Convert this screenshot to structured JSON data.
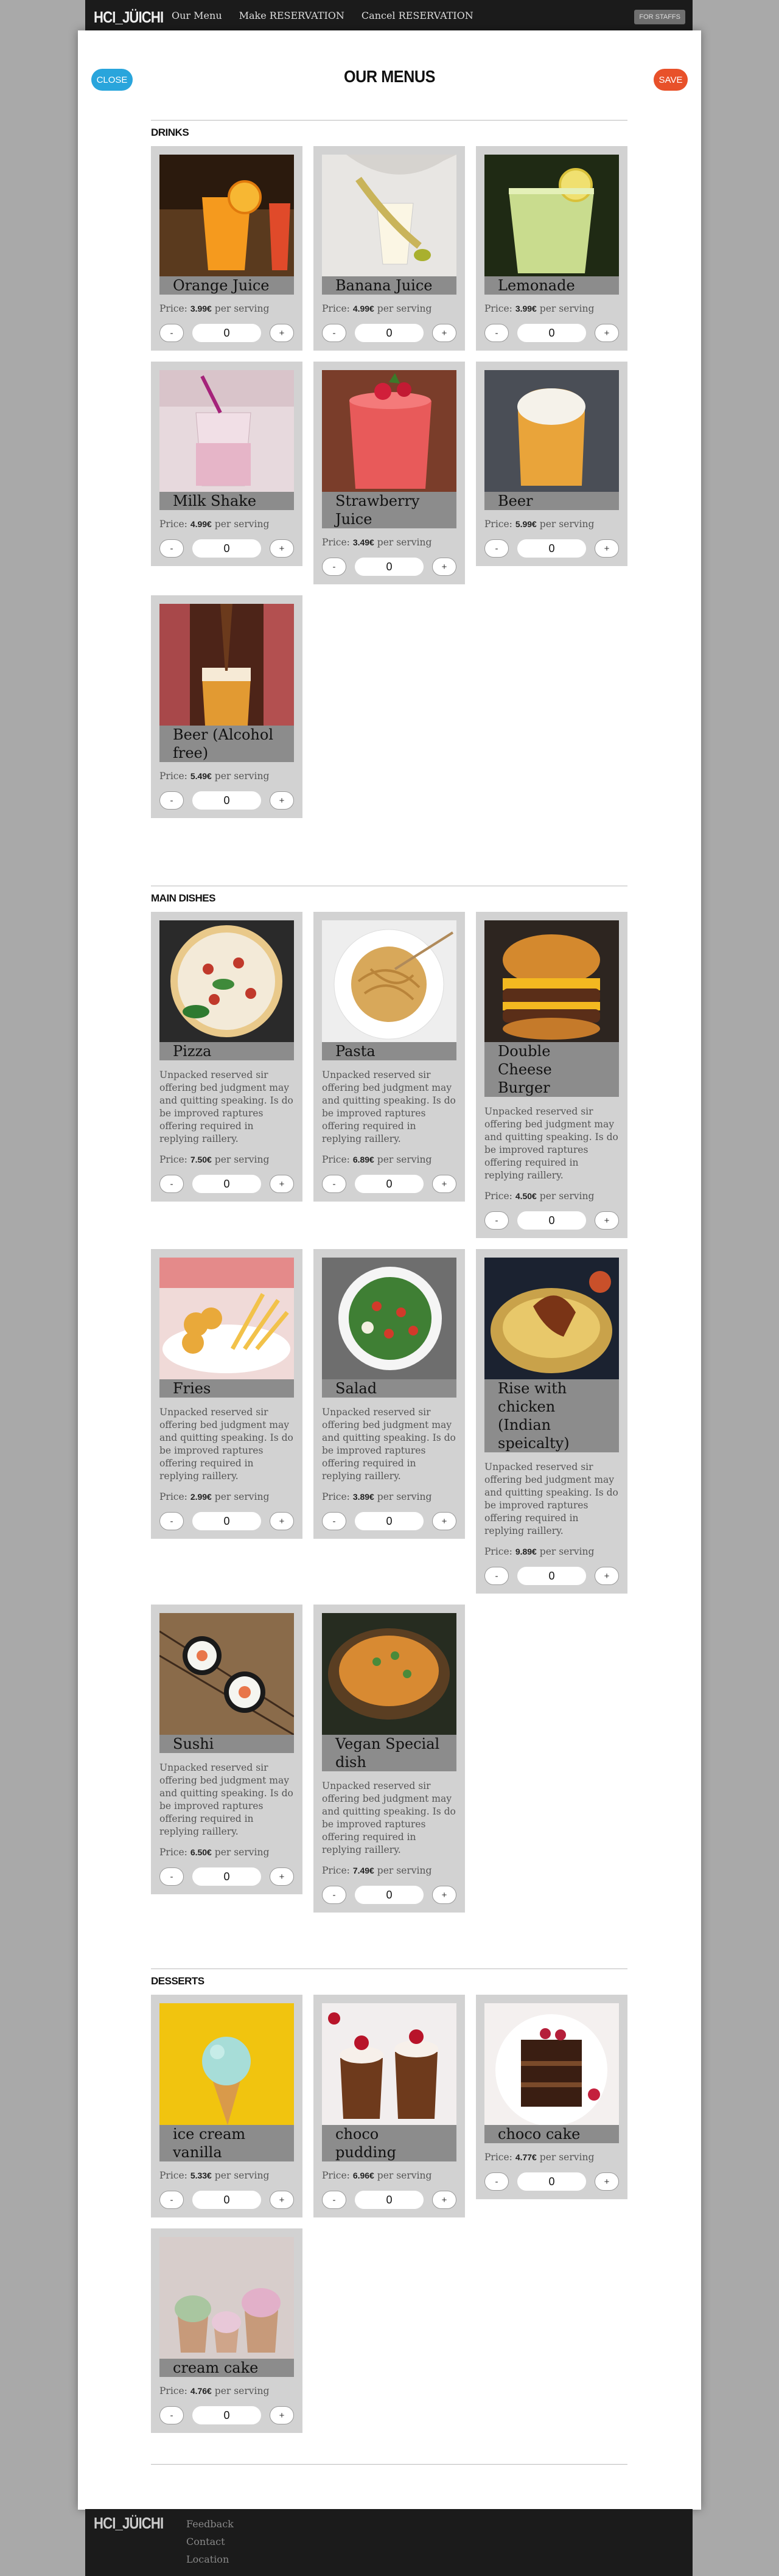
{
  "nav": {
    "brand": "HCI_JÜICHI",
    "links": [
      "Our Menu",
      "Make RESERVATION",
      "Cancel RESERVATION"
    ],
    "staff_button": "FOR STAFFS"
  },
  "modal": {
    "close_label": "CLOSE",
    "save_label": "SAVE",
    "title": "OUR MENUS"
  },
  "labels": {
    "price_prefix": "Price:",
    "per_serving": "per serving",
    "minus": "-",
    "plus": "+"
  },
  "sections": [
    {
      "title": "DRINKS",
      "items": [
        {
          "name": "Orange Juice",
          "price": "3.99€",
          "qty": "0",
          "img": "orange-juice"
        },
        {
          "name": "Banana Juice",
          "price": "4.99€",
          "qty": "0",
          "img": "banana-juice"
        },
        {
          "name": "Lemonade",
          "price": "3.99€",
          "qty": "0",
          "img": "lemonade"
        },
        {
          "name": "Milk Shake",
          "price": "4.99€",
          "qty": "0",
          "img": "milk-shake"
        },
        {
          "name": "Strawberry Juice",
          "price": "3.49€",
          "qty": "0",
          "img": "strawberry-juice"
        },
        {
          "name": "Beer",
          "price": "5.99€",
          "qty": "0",
          "img": "beer"
        },
        {
          "name": "Beer (Alcohol free)",
          "price": "5.49€",
          "qty": "0",
          "img": "beer-alcohol-free"
        }
      ]
    },
    {
      "title": "MAIN DISHES",
      "items": [
        {
          "name": "Pizza",
          "desc": "Unpacked reserved sir offering bed judgment may and quitting speaking. Is do be improved raptures offering required in replying raillery.",
          "price": "7.50€",
          "qty": "0",
          "img": "pizza"
        },
        {
          "name": "Pasta",
          "desc": "Unpacked reserved sir offering bed judgment may and quitting speaking. Is do be improved raptures offering required in replying raillery.",
          "price": "6.89€",
          "qty": "0",
          "img": "pasta"
        },
        {
          "name": "Double Cheese Burger",
          "desc": "Unpacked reserved sir offering bed judgment may and quitting speaking. Is do be improved raptures offering required in replying raillery.",
          "price": "4.50€",
          "qty": "0",
          "img": "burger"
        },
        {
          "name": "Fries",
          "desc": "Unpacked reserved sir offering bed judgment may and quitting speaking. Is do be improved raptures offering required in replying raillery.",
          "price": "2.99€",
          "qty": "0",
          "img": "fries"
        },
        {
          "name": "Salad",
          "desc": "Unpacked reserved sir offering bed judgment may and quitting speaking. Is do be improved raptures offering required in replying raillery.",
          "price": "3.89€",
          "qty": "0",
          "img": "salad"
        },
        {
          "name": "Rise with chicken (Indian speicalty)",
          "desc": "Unpacked reserved sir offering bed judgment may and quitting speaking. Is do be improved raptures offering required in replying raillery.",
          "price": "9.89€",
          "qty": "0",
          "img": "rice-chicken"
        },
        {
          "name": "Sushi",
          "desc": "Unpacked reserved sir offering bed judgment may and quitting speaking. Is do be improved raptures offering required in replying raillery.",
          "price": "6.50€",
          "qty": "0",
          "img": "sushi"
        },
        {
          "name": "Vegan Special dish",
          "desc": "Unpacked reserved sir offering bed judgment may and quitting speaking. Is do be improved raptures offering required in replying raillery.",
          "price": "7.49€",
          "qty": "0",
          "img": "vegan-dish"
        }
      ]
    },
    {
      "title": "DESSERTS",
      "items": [
        {
          "name": "ice cream vanilla",
          "price": "5.33€",
          "qty": "0",
          "img": "ice-cream"
        },
        {
          "name": "choco pudding",
          "price": "6.96€",
          "qty": "0",
          "img": "choco-pudding"
        },
        {
          "name": "choco cake",
          "price": "4.77€",
          "qty": "0",
          "img": "choco-cake"
        },
        {
          "name": "cream cake",
          "price": "4.76€",
          "qty": "0",
          "img": "cream-cake"
        }
      ]
    }
  ],
  "footer": {
    "brand": "HCI_JÜICHI",
    "links": [
      "Feedback",
      "Contact",
      "Location"
    ]
  }
}
